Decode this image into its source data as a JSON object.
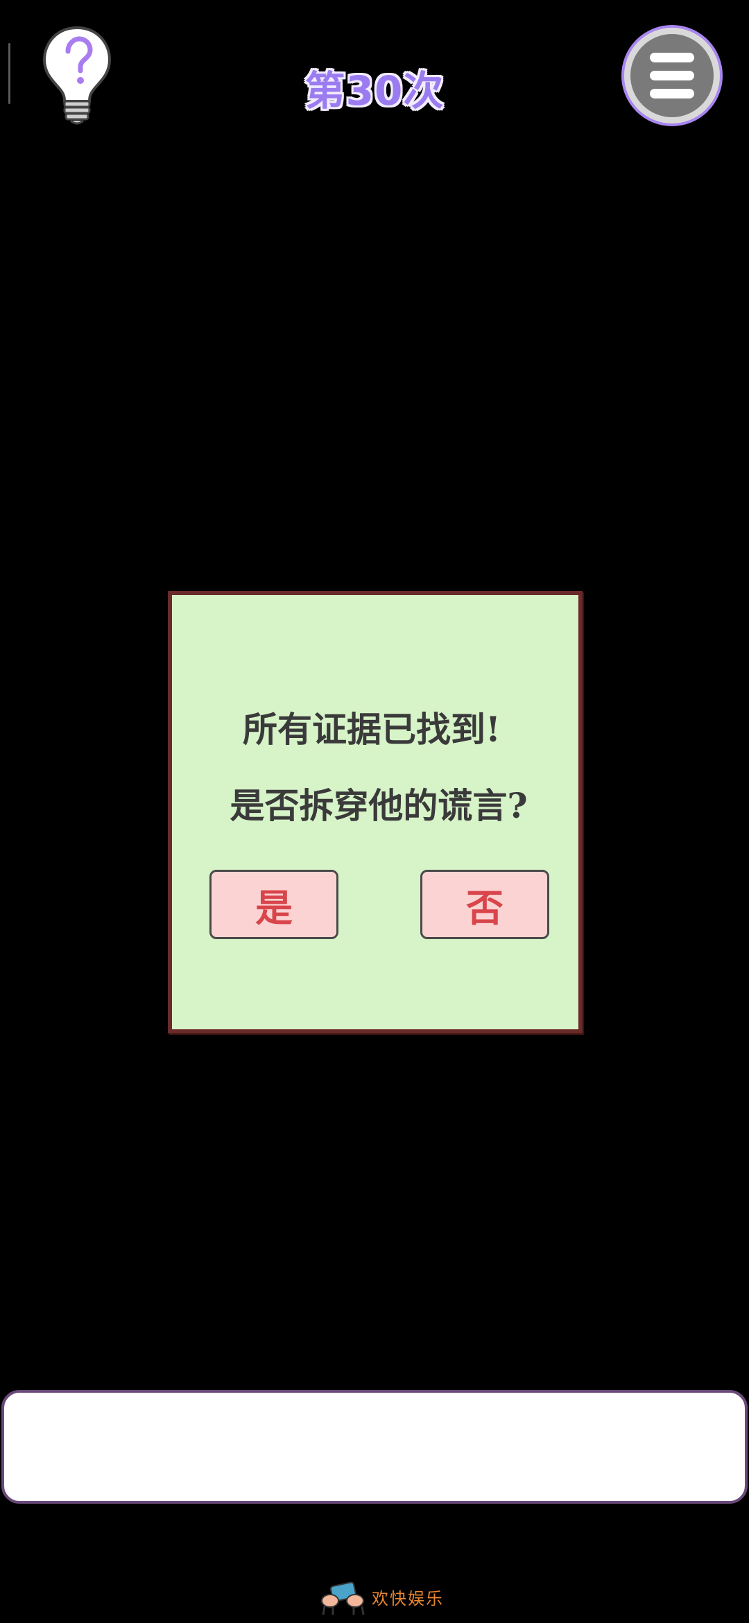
{
  "header": {
    "level_title": "第30次",
    "hint_icon": "lightbulb-question-icon",
    "menu_icon": "hamburger-menu-icon"
  },
  "dialog": {
    "line1": "所有证据已找到!",
    "line2": "是否拆穿他的谎言?",
    "yes_label": "是",
    "no_label": "否"
  },
  "message_box": {
    "text": ""
  },
  "watermark": {
    "text": "欢快娱乐"
  },
  "colors": {
    "background": "#000000",
    "title": "#9b7cf0",
    "dialog_bg": "#d7f3c8",
    "dialog_border": "#6b2a2a",
    "button_bg": "#fbd3d3",
    "button_text": "#d8454a",
    "menu_ring": "#a885f0"
  }
}
